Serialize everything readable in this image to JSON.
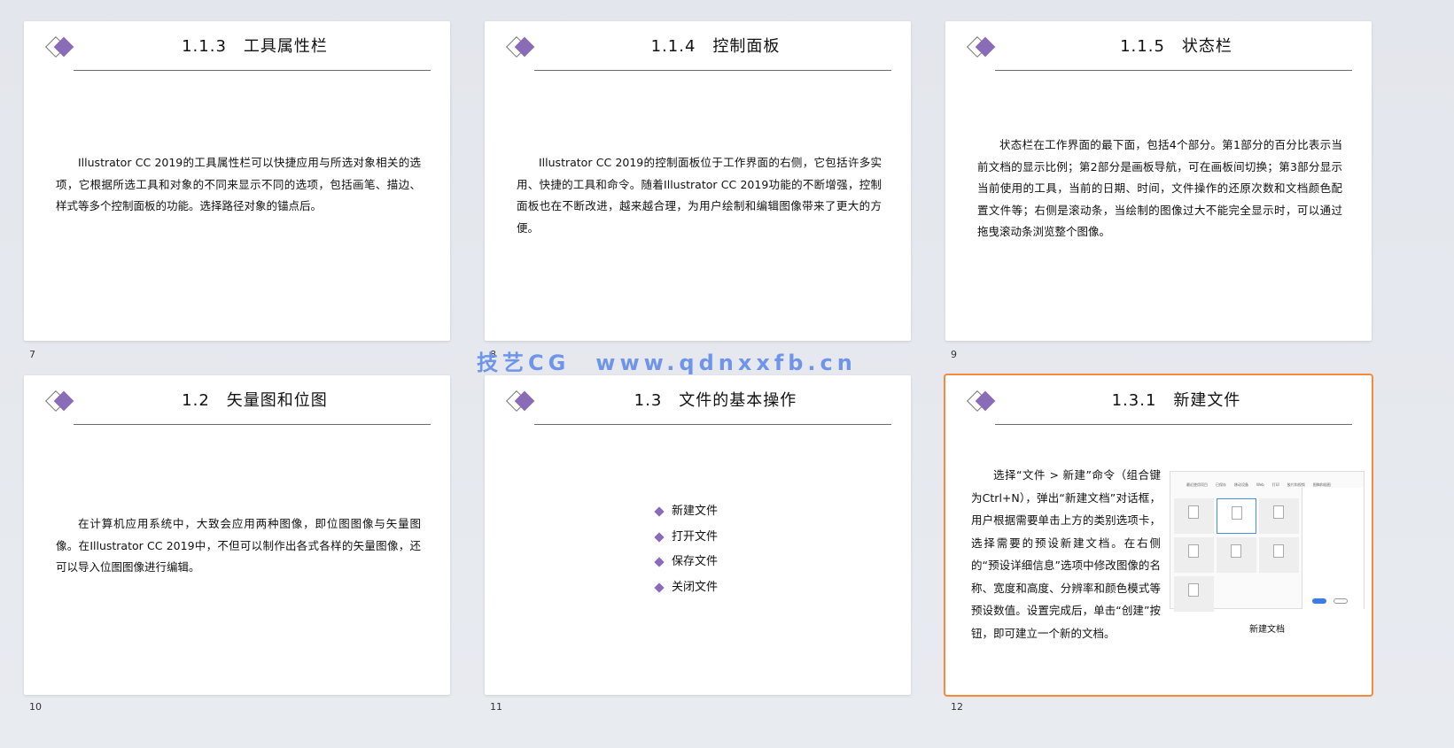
{
  "slides": [
    {
      "number": "7",
      "title": "1.1.3　工具属性栏",
      "body": "Illustrator CC 2019的工具属性栏可以快捷应用与所选对象相关的选项，它根据所选工具和对象的不同来显示不同的选项，包括画笔、描边、样式等多个控制面板的功能。选择路径对象的锚点后。"
    },
    {
      "number": "8",
      "title": "1.1.4　控制面板",
      "body": "Illustrator CC 2019的控制面板位于工作界面的右侧，它包括许多实用、快捷的工具和命令。随着Illustrator CC 2019功能的不断增强，控制面板也在不断改进，越来越合理，为用户绘制和编辑图像带来了更大的方便。"
    },
    {
      "number": "9",
      "title": "1.1.5　状态栏",
      "body": "状态栏在工作界面的最下面，包括4个部分。第1部分的百分比表示当前文档的显示比例；第2部分是画板导航，可在画板间切换；第3部分显示当前使用的工具，当前的日期、时间，文件操作的还原次数和文档颜色配置文件等；右侧是滚动条，当绘制的图像过大不能完全显示时，可以通过拖曳滚动条浏览整个图像。"
    },
    {
      "number": "10",
      "title": "1.2　矢量图和位图",
      "body": "在计算机应用系统中，大致会应用两种图像，即位图图像与矢量图像。在Illustrator CC 2019中，不但可以制作出各式各样的矢量图像，还可以导入位图图像进行编辑。"
    },
    {
      "number": "11",
      "title": "1.3　文件的基本操作",
      "bullets": [
        "新建文件",
        "打开文件",
        "保存文件",
        "关闭文件"
      ]
    },
    {
      "number": "12",
      "title": "1.3.1　新建文件",
      "body": "选择“文件 > 新建”命令（组合键为Ctrl+N），弹出“新建文档”对话框，用户根据需要单击上方的类别选项卡，选择需要的预设新建文档。在右侧的“预设详细信息”选项中修改图像的名称、宽度和高度、分辨率和颜色模式等预设数值。设置完成后，单击“创建”按钮，即可建立一个新的文档。",
      "caption": "新建文档",
      "dialog_tabs": [
        "最近使用项目",
        "已保存",
        "移动设备",
        "Web",
        "打印",
        "胶片和视频",
        "图稿和插图"
      ]
    }
  ],
  "watermark": "技艺CG　www.qdnxxfb.cn",
  "colors": {
    "accent": "#8a6bb8",
    "selection": "#f58a3a",
    "watermark": "#6f95ea"
  }
}
